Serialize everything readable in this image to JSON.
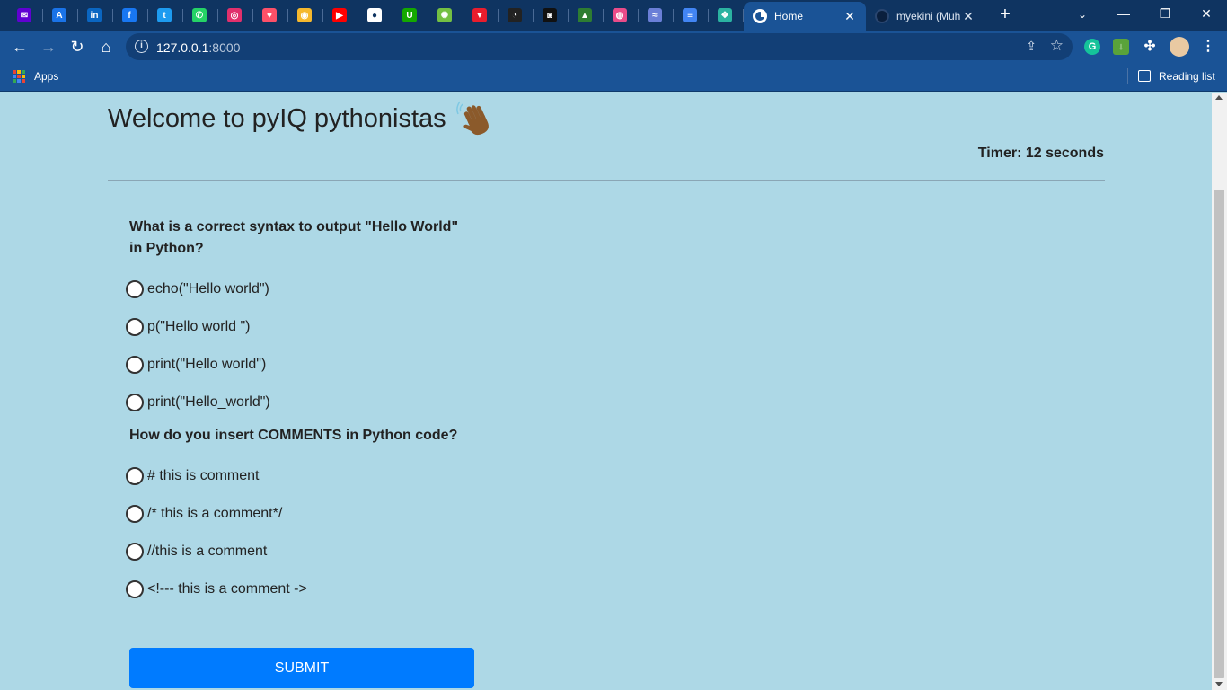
{
  "browser": {
    "tabs": [
      {
        "title": "Home",
        "active": true
      },
      {
        "title": "myekini (Muh",
        "active": false
      }
    ],
    "url": {
      "host": "127.0.0.1",
      "port": ":8000"
    },
    "bookmarks": {
      "apps_label": "Apps",
      "reading_list_label": "Reading list"
    },
    "pinned_icons": [
      "yahoo-mail-icon",
      "aws-icon",
      "linkedin-icon",
      "facebook-icon",
      "twitter-icon",
      "whatsapp-icon",
      "instagram-icon",
      "tinder-icon",
      "coinbase-icon",
      "youtube-icon",
      "site-icon",
      "upwork-icon",
      "dribbble-ball-icon",
      "vercel-icon",
      "incognito-icon",
      "streaming-icon",
      "mountain-icon",
      "dribbble-icon",
      "mail-icon",
      "docs-icon",
      "bookmark-app-icon"
    ]
  },
  "page": {
    "title": "Welcome to pyIQ pythonistas",
    "timer_label": "Timer:",
    "timer_value": "12 seconds",
    "submit_label": "SUBMIT"
  },
  "questions": [
    {
      "text": "What is a correct syntax to output \"Hello World\" in Python?",
      "options": [
        "echo(\"Hello world\")",
        "p(\"Hello world \")",
        "print(\"Hello world\")",
        "print(\"Hello_world\")"
      ]
    },
    {
      "text": "How do you insert COMMENTS in Python code?",
      "options": [
        "# this is comment",
        "/* this is a comment*/",
        "//this is a comment",
        "<!--- this is a comment ->"
      ]
    }
  ],
  "colors": {
    "page_background": "#add8e6",
    "chrome_tabstrip": "#0f3461",
    "chrome_toolbar": "#1a5396",
    "submit_button": "#007bff"
  }
}
